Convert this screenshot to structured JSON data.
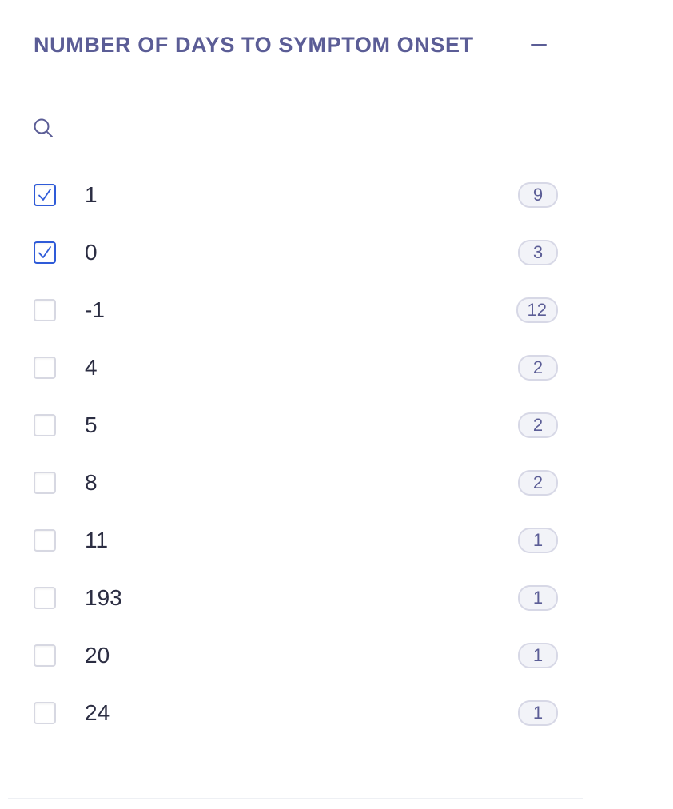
{
  "facet": {
    "title": "NUMBER OF DAYS TO SYMPTOM ONSET",
    "collapse_icon": "minus-icon",
    "search": {
      "icon": "search-icon",
      "placeholder": "",
      "value": ""
    },
    "options": [
      {
        "label": "1",
        "count": "9",
        "checked": true
      },
      {
        "label": "0",
        "count": "3",
        "checked": true
      },
      {
        "label": "-1",
        "count": "12",
        "checked": false
      },
      {
        "label": "4",
        "count": "2",
        "checked": false
      },
      {
        "label": "5",
        "count": "2",
        "checked": false
      },
      {
        "label": "8",
        "count": "2",
        "checked": false
      },
      {
        "label": "11",
        "count": "1",
        "checked": false
      },
      {
        "label": "193",
        "count": "1",
        "checked": false
      },
      {
        "label": "20",
        "count": "1",
        "checked": false
      },
      {
        "label": "24",
        "count": "1",
        "checked": false
      }
    ]
  },
  "colors": {
    "title": "#5b5d96",
    "checkbox_checked": "#2f5bd8",
    "checkbox_border": "#d7d8e2",
    "badge_bg": "#f2f3f8",
    "text": "#2b2d42"
  }
}
